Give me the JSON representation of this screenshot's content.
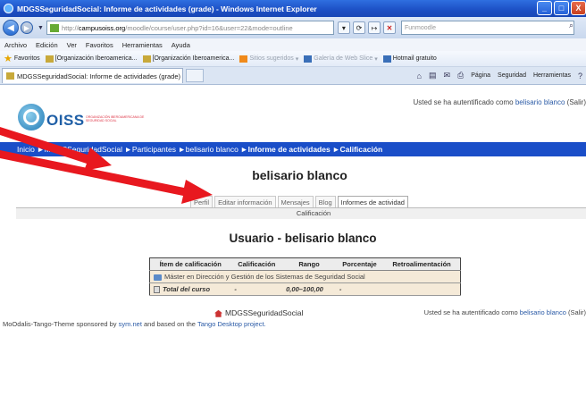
{
  "window": {
    "title": "MDGSSeguridadSocial: Informe de actividades (grade) - Windows Internet Explorer",
    "controls": [
      "_",
      "□",
      "X"
    ]
  },
  "address": {
    "url_prefix": "http://",
    "url_host": "campusoiss.org",
    "url_path": "/moodle/course/user.php?id=16&user=22&mode=outline",
    "search_placeholder": "Funmoodle"
  },
  "menubar": [
    "Archivo",
    "Edición",
    "Ver",
    "Favoritos",
    "Herramientas",
    "Ayuda"
  ],
  "favbar": {
    "label": "Favoritos",
    "items": [
      "[Organización Iberoamerica...",
      "[Organización Iberoamerica...",
      "Sitios sugeridos",
      "Galería de Web Slice",
      "Hotmail gratuito"
    ]
  },
  "tab": {
    "title": "MDGSSeguridadSocial: Informe de actividades (grade)"
  },
  "cmdbar": [
    "Página",
    "Seguridad",
    "Herramientas"
  ],
  "site": {
    "logo_text": "OISS",
    "logo_sub": "ORGANIZACIÓN IBEROAMERICANA DE SEGURIDAD SOCIAL",
    "auth_prefix": "Usted se ha autentificado como",
    "auth_user": "belisario blanco",
    "auth_suffix": "(Salir)"
  },
  "breadcrumb": [
    "Inicio",
    "MDGSSeguridadSocial",
    "Participantes",
    "belisario blanco",
    "Informe de actividades",
    "Calificación"
  ],
  "profile": {
    "name": "belisario blanco",
    "tabs": [
      "Perfil",
      "Editar información",
      "Mensajes",
      "Blog",
      "Informes de actividad"
    ],
    "subtab": "Calificación"
  },
  "report": {
    "heading": "Usuario - belisario blanco",
    "columns": [
      "Ítem de calificación",
      "Calificación",
      "Rango",
      "Porcentaje",
      "Retroalimentación"
    ],
    "category": "Máster en Dirección y Gestión de los Sistemas de Seguridad Social",
    "total_label": "Total del curso",
    "total_grade": "-",
    "total_range": "0,00–100,00",
    "total_pct": "-"
  },
  "footer": {
    "home": "MDGSSeguridadSocial",
    "auth_prefix": "Usted se ha autentificado como",
    "auth_user": "belisario blanco",
    "auth_suffix": "(Salir)",
    "theme_prefix": "MoOdalis-Tango-Theme sponsored by",
    "theme_link1": "sym.net",
    "theme_mid": "and based on the",
    "theme_link2": "Tango Desktop project."
  },
  "colors": {
    "nav_strip": "#1a4ec8",
    "annotation_arrow": "#e8181f",
    "table_row": "#f5ead8"
  }
}
